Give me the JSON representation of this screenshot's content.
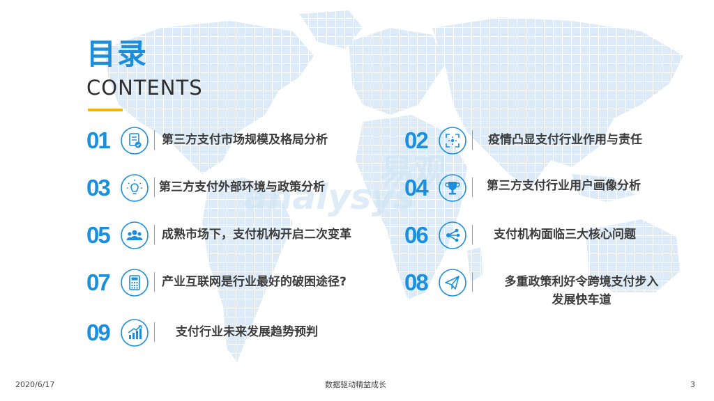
{
  "header": {
    "title": "目录",
    "subtitle": "CONTENTS"
  },
  "watermark": {
    "text_en": "analysys",
    "text_cn": "易观"
  },
  "items": [
    {
      "num": "01",
      "label": "第三方支付市场规模及格局分析",
      "icon": "document-check-icon"
    },
    {
      "num": "02",
      "label": "疫情凸显支付行业作用与责任",
      "icon": "focus-scan-icon"
    },
    {
      "num": "03",
      "label": "第三方支付外部环境与政策分析",
      "icon": "lightbulb-icon"
    },
    {
      "num": "04",
      "label": "第三方支付行业用户画像分析",
      "icon": "trophy-icon"
    },
    {
      "num": "05",
      "label": "成熟市场下，支付机构开启二次变革",
      "icon": "users-group-icon"
    },
    {
      "num": "06",
      "label": "支付机构面临三大核心问题",
      "icon": "share-icon"
    },
    {
      "num": "07",
      "label": "产业互联网是行业最好的破困途径?",
      "icon": "calculator-icon"
    },
    {
      "num": "08",
      "label_line1": "多重政策利好令跨境支付步入",
      "label_line2": "发展快车道",
      "icon": "paper-plane-icon"
    },
    {
      "num": "09",
      "label": "支付行业未来发展趋势预判",
      "icon": "growth-chart-icon"
    }
  ],
  "footer": {
    "date": "2020/6/17",
    "slogan": "数据驱动精益成长",
    "page": "3"
  },
  "colors": {
    "accent": "#1b8fdc",
    "bar": "#f2b600",
    "text": "#3b3b3b",
    "map": "#dcebf7"
  }
}
